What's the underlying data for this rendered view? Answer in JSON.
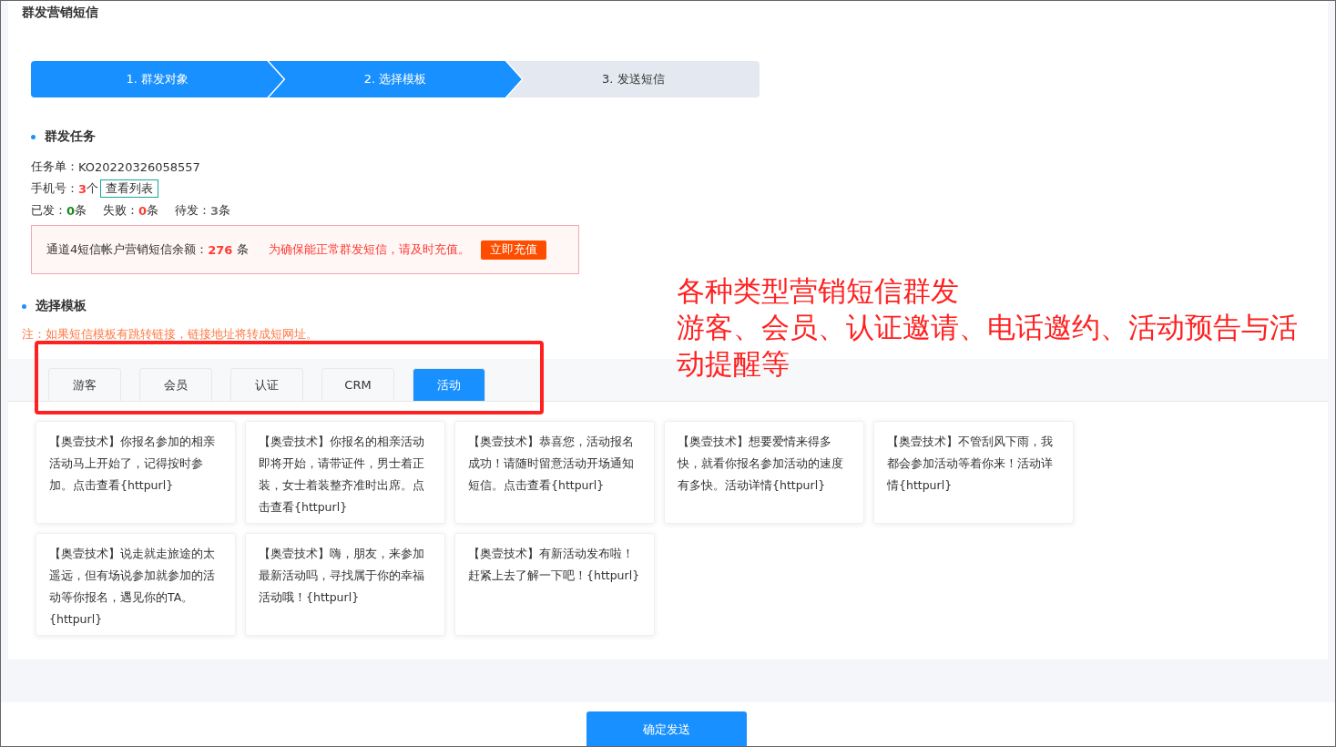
{
  "page_title": "群发营销短信",
  "steps": [
    {
      "label": "1. 群发对象",
      "active": true
    },
    {
      "label": "2. 选择模板",
      "active": true
    },
    {
      "label": "3. 发送短信",
      "active": false
    }
  ],
  "task_section": {
    "heading": "群发任务",
    "order_label": "任务单：",
    "order_value": "KO20220326058557",
    "phone_label": "手机号：",
    "phone_count": "3",
    "phone_unit": "个",
    "view_list_button": "查看列表",
    "stats": [
      {
        "label": "已发：",
        "value": "0",
        "unit": "条",
        "color": "#1a8a1a"
      },
      {
        "label": "失败：",
        "value": "0",
        "unit": "条",
        "color": "#ff3b30"
      },
      {
        "label": "待发：",
        "value": "3",
        "unit": "条",
        "color": "#777777"
      }
    ]
  },
  "balance_alert": {
    "label": "通道4短信帐户营销短信余额：",
    "amount": "276",
    "unit": "条",
    "warning": "为确保能正常群发短信，请及时充值。",
    "recharge_button": "立即充值"
  },
  "template_section": {
    "heading": "选择模板",
    "note": "注：如果短信模板有跳转链接，链接地址将转成短网址。"
  },
  "tabs": [
    {
      "label": "游客",
      "selected": false
    },
    {
      "label": "会员",
      "selected": false
    },
    {
      "label": "认证",
      "selected": false
    },
    {
      "label": "CRM",
      "selected": false
    },
    {
      "label": "活动",
      "selected": true
    }
  ],
  "templates": [
    "【奥壹技术】你报名参加的相亲活动马上开始了，记得按时参加。点击查看{httpurl}",
    "【奥壹技术】你报名的相亲活动即将开始，请带证件，男士着正装，女士着装整齐准时出席。点击查看{httpurl}",
    "【奥壹技术】恭喜您，活动报名成功！请随时留意活动开场通知短信。点击查看{httpurl}",
    "【奥壹技术】想要爱情来得多快，就看你报名参加活动的速度有多快。活动详情{httpurl}",
    "【奥壹技术】不管刮风下雨，我都会参加活动等着你来！活动详情{httpurl}",
    "【奥壹技术】说走就走旅途的太遥远，但有场说参加就参加的活动等你报名，遇见你的TA。{httpurl}",
    "【奥壹技术】嗨，朋友，来参加最新活动吗，寻找属于你的幸福活动哦！{httpurl}",
    "【奥壹技术】有新活动发布啦！赶紧上去了解一下吧！{httpurl}"
  ],
  "submit_button": "确定发送",
  "annotation": {
    "lines": [
      "各种类型营销短信群发",
      "游客、会员、认证邀请、电话邀约、活动预告与活动提醒等"
    ]
  }
}
